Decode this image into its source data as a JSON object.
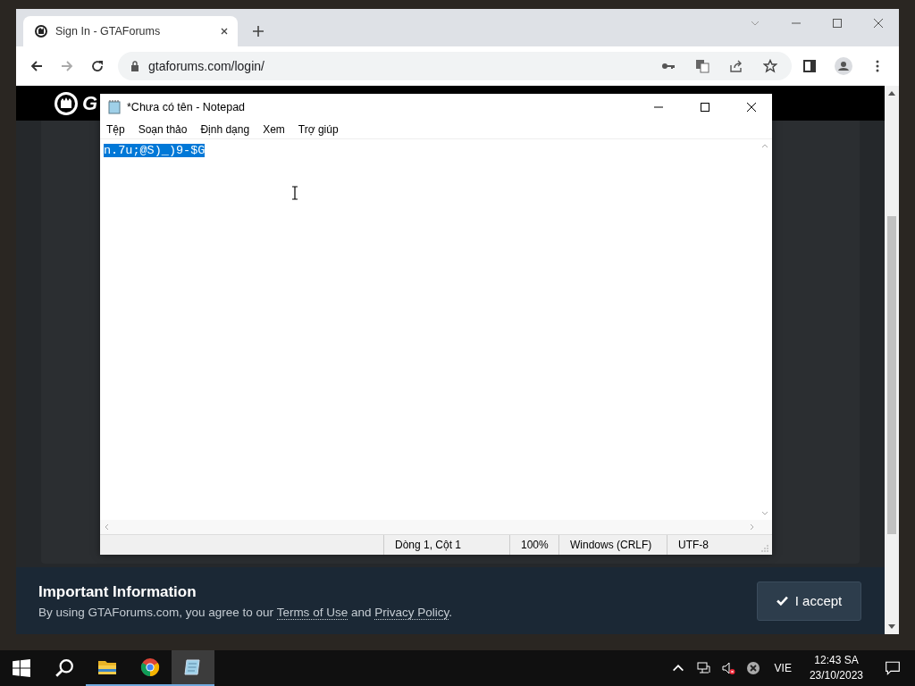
{
  "browser": {
    "tabs": [
      {
        "title": "Sign In - GTAForums",
        "selected": true
      }
    ],
    "address": "gtaforums.com/login/"
  },
  "site": {
    "logo_text": "G",
    "notice": {
      "title": "Important Information",
      "segments": [
        {
          "kind": "text",
          "text": "By using GTAForums.com, you agree to our "
        },
        {
          "kind": "link",
          "text": "Terms of Use"
        },
        {
          "kind": "text",
          "text": " and "
        },
        {
          "kind": "link",
          "text": "Privacy Policy"
        },
        {
          "kind": "text",
          "text": "."
        }
      ],
      "button": "I accept"
    }
  },
  "notepad": {
    "title": "*Chưa có tên - Notepad",
    "menu": [
      "Tệp",
      "Soạn thảo",
      "Định dạng",
      "Xem",
      "Trợ giúp"
    ],
    "content": "n.7u;@S)_)9-$G",
    "content_selected": true,
    "status": [
      "Dòng 1, Cột 1",
      "100%",
      "Windows (CRLF)",
      "UTF-8"
    ]
  },
  "taskbar": {
    "apps": [
      {
        "kind": "files",
        "active": false
      },
      {
        "kind": "chrome",
        "active": false
      },
      {
        "kind": "notepad",
        "active": true
      }
    ],
    "language": "VIE",
    "time": "12:43 SA",
    "date": "23/10/2023"
  }
}
